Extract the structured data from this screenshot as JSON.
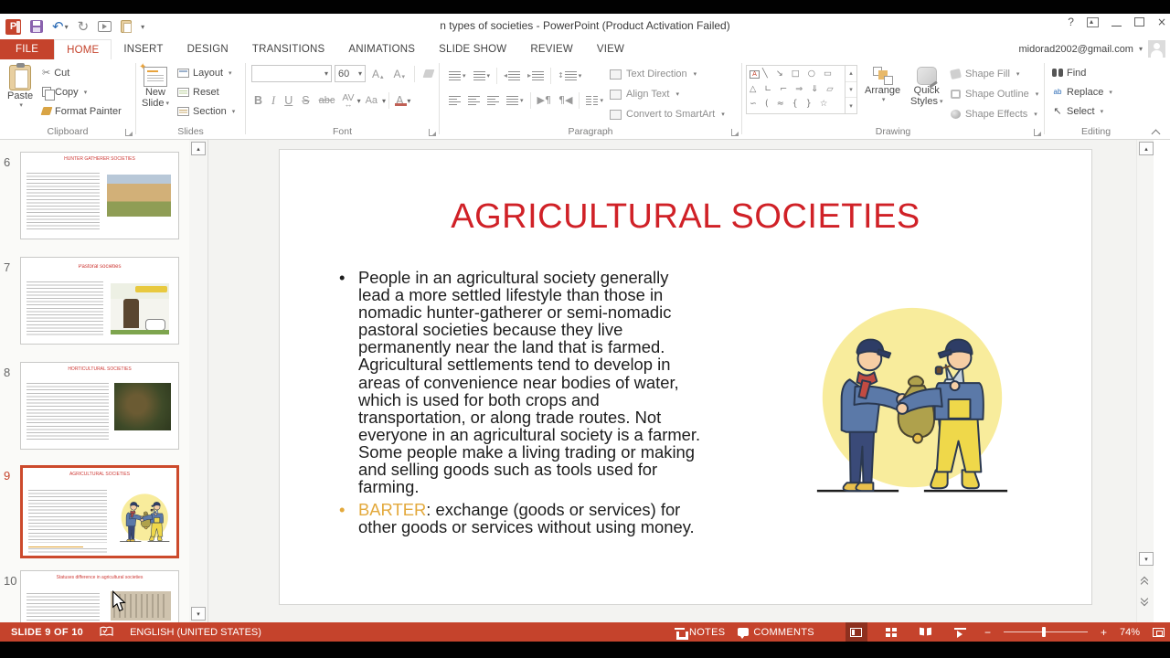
{
  "window": {
    "title": "n types of societies - PowerPoint (Product Activation Failed)",
    "help": "?",
    "account_email": "midorad2002@gmail.com"
  },
  "tabs": {
    "file": "FILE",
    "items": [
      "HOME",
      "INSERT",
      "DESIGN",
      "TRANSITIONS",
      "ANIMATIONS",
      "SLIDE SHOW",
      "REVIEW",
      "VIEW"
    ]
  },
  "ribbon": {
    "clipboard": {
      "label": "Clipboard",
      "paste": "Paste",
      "cut": "Cut",
      "copy": "Copy",
      "format_painter": "Format Painter"
    },
    "slides": {
      "label": "Slides",
      "new_slide_1": "New",
      "new_slide_2": "Slide",
      "layout": "Layout",
      "reset": "Reset",
      "section": "Section"
    },
    "font": {
      "label": "Font",
      "name_value": "",
      "size_value": "60",
      "grow": "A",
      "shrink": "A",
      "bold": "B",
      "italic": "I",
      "underline": "U",
      "strikethrough": "S",
      "clear": "abc",
      "spacing": "AV",
      "case": "Aa",
      "color": "A"
    },
    "paragraph": {
      "label": "Paragraph",
      "pilcrow_ltr": "▶¶",
      "pilcrow_rtl": "¶◀",
      "text_direction": "Text Direction",
      "align_text": "Align Text",
      "smartart": "Convert to SmartArt"
    },
    "drawing": {
      "label": "Drawing",
      "arrange": "Arrange",
      "quick_styles_1": "Quick",
      "quick_styles_2": "Styles",
      "shape_fill": "Shape Fill",
      "shape_outline": "Shape Outline",
      "shape_effects": "Shape Effects",
      "textbox_glyph": "A",
      "shapes_row1": "╲ ↘ □ ○ ▭",
      "shapes_row2": "△ ∟ ⌐ ⇒ ⇓ ▱",
      "shapes_row3": "∽ ( ≈ { } ☆"
    },
    "editing": {
      "label": "Editing",
      "find": "Find",
      "replace": "Replace",
      "select": "Select",
      "replace_glyph": "ab",
      "select_glyph": "↖"
    }
  },
  "icons": {
    "caret_down": "▾",
    "caret_up": "▴",
    "tri_left": "◂",
    "tri_right": "▸",
    "undo": "↶",
    "redo": "↻",
    "cut": "✂",
    "updown": "↕",
    "grow_mark": "▴",
    "shrink_mark": "▾"
  },
  "thumbnails": {
    "items": [
      {
        "number": "6",
        "title": "HUNTER GATHERER SOCIETIES"
      },
      {
        "number": "7",
        "title": "Pastoral societies"
      },
      {
        "number": "8",
        "title": "HORTICULTURAL SOCIETIES"
      },
      {
        "number": "9",
        "title": "AGRICULTURAL SOCIETIES"
      },
      {
        "number": "10",
        "title": "Statuses difference in agricultural societies"
      }
    ]
  },
  "slide": {
    "title": "AGRICULTURAL SOCIETIES",
    "bullet_glyph": "•",
    "bullet1": "People in an agricultural society generally\nlead a more settled lifestyle than those in\nnomadic hunter-gatherer or semi-nomadic\npastoral societies because they live\npermanently near the land that is farmed.\nAgricultural settlements tend to develop in\nareas of convenience near bodies of water,\nwhich is used for both crops and\ntransportation, or along trade routes. Not\neveryone in an agricultural society is a farmer.\nSome people make a living trading or making\nand selling goods such as tools used for\nfarming.",
    "bullet2_term": "BARTER",
    "bullet2_rest": ": exchange (goods or services) for\nother goods or services without using money."
  },
  "statusbar": {
    "slide_indicator": "SLIDE 9 OF 10",
    "language": "ENGLISH (UNITED STATES)",
    "notes": "NOTES",
    "comments": "COMMENTS",
    "zoom_out": "−",
    "zoom_in": "+",
    "zoom_level": "74%"
  },
  "colors": {
    "accent": "#C5432C",
    "title_red": "#D02127",
    "barter_gold": "#E3A93C",
    "selection_border": "#CC4A2C"
  }
}
